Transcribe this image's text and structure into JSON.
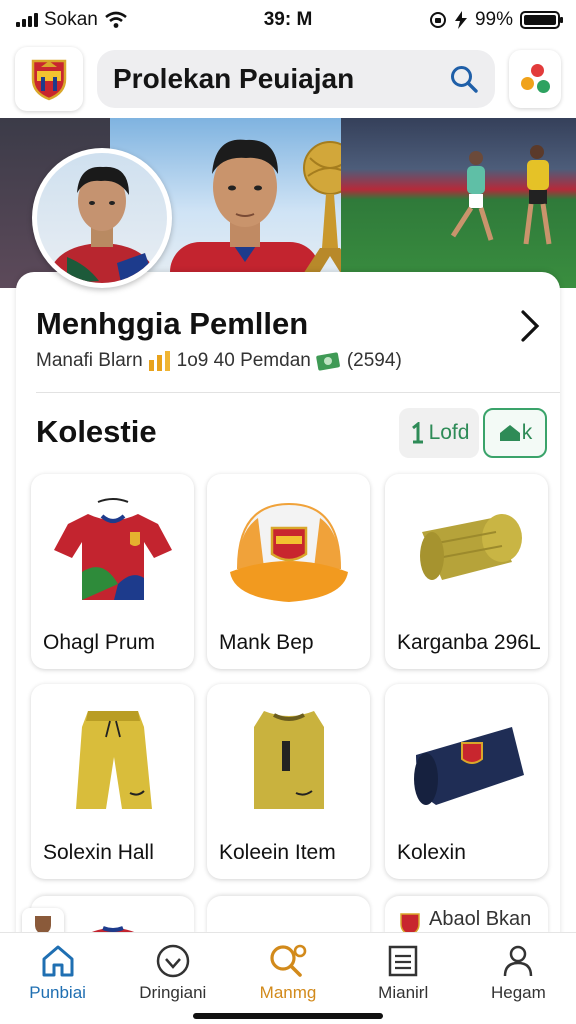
{
  "status_bar": {
    "carrier": "Sokan",
    "time": "39: M",
    "battery": "99%",
    "battery_level": 0.99
  },
  "header": {
    "title": "Prolekan Peuiajan",
    "search_icon": "search-icon",
    "logo_icon": "club-crest-icon",
    "apps_icon": "apps-dots-icon"
  },
  "profile": {
    "name": "Menhggia Pemllen",
    "meta_a": "Manafi Blarn",
    "meta_b": "1o9 40 Pemdan",
    "meta_c": "(2594)"
  },
  "collection": {
    "title": "Kolestie",
    "filter_a_label": "Lofd",
    "filter_b_label": "k",
    "items": [
      {
        "label": "Ohagl Prum",
        "icon": "jersey-icon"
      },
      {
        "label": "Mank Bep",
        "icon": "cap-icon"
      },
      {
        "label": "Karganba 296L",
        "icon": "towel-roll-icon"
      },
      {
        "label": "Solexin Hall",
        "icon": "shorts-icon"
      },
      {
        "label": "Koleein Item",
        "icon": "vest-icon"
      },
      {
        "label": "Kolexin",
        "icon": "scarf-icon"
      }
    ],
    "peek_label": "Abaol Bkan"
  },
  "nav": [
    {
      "label": "Punbiai",
      "icon": "home-icon"
    },
    {
      "label": "Dringiani",
      "icon": "heart-icon"
    },
    {
      "label": "Manmg",
      "icon": "search-gear-icon"
    },
    {
      "label": "Mianirl",
      "icon": "list-icon"
    },
    {
      "label": "Hegam",
      "icon": "profile-icon"
    }
  ],
  "colors": {
    "active": "#1f6fb2",
    "accent": "#d28a1b",
    "green": "#2e8b57"
  }
}
